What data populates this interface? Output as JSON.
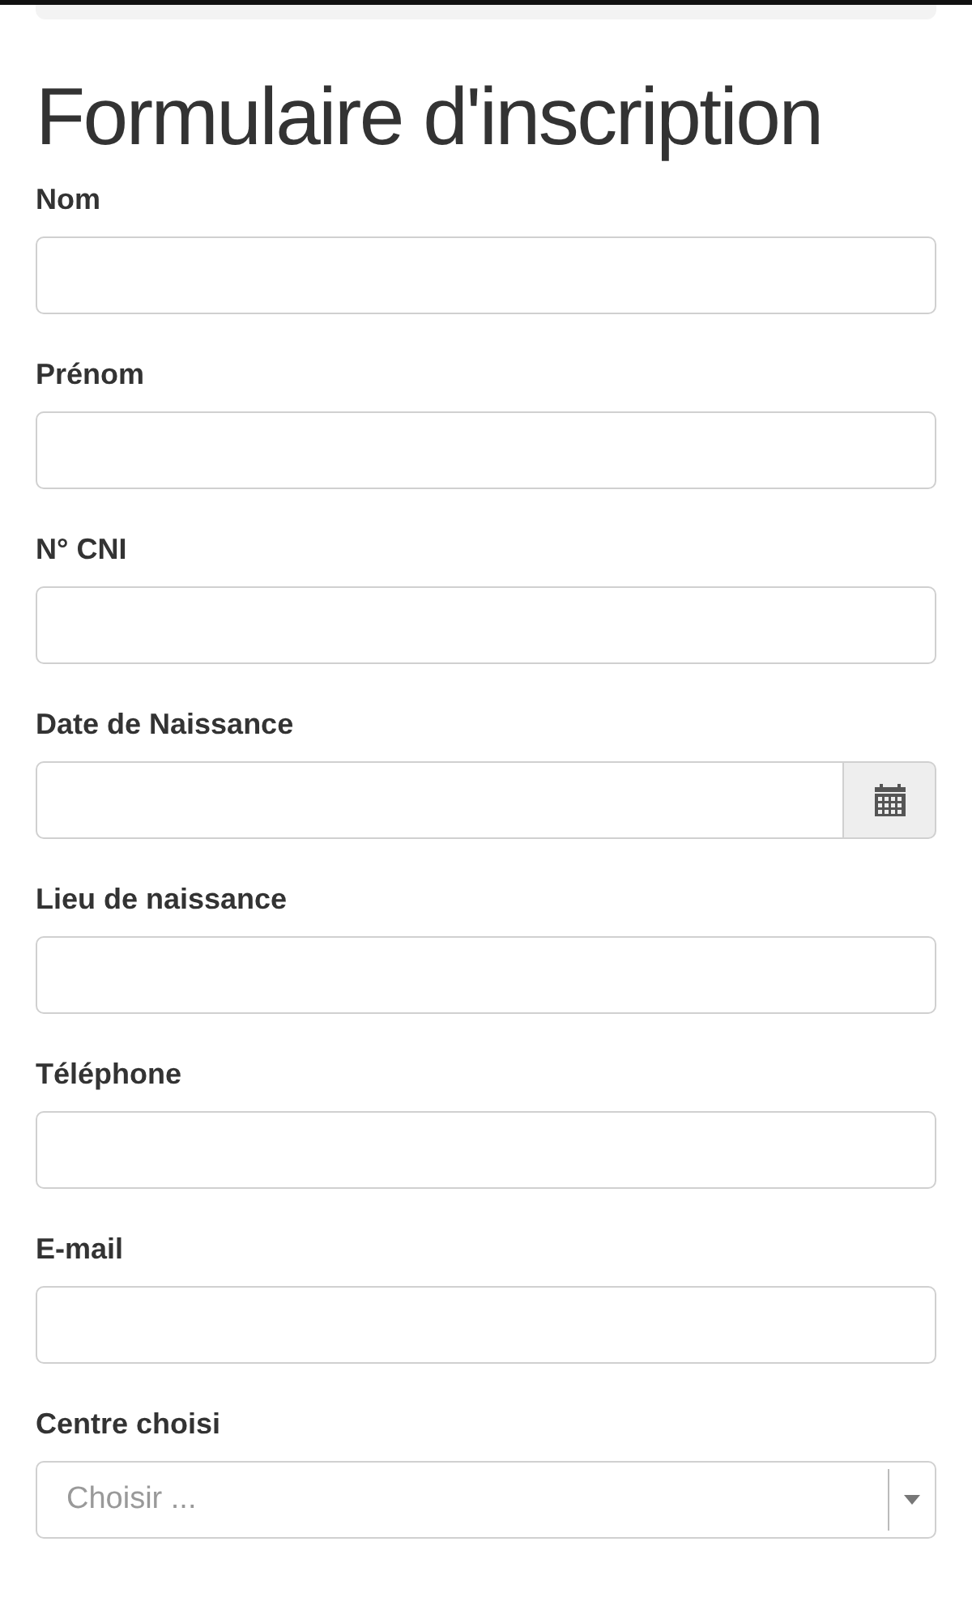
{
  "title": "Formulaire d'inscription",
  "fields": [
    {
      "label": "Nom",
      "kind": "text"
    },
    {
      "label": "Prénom",
      "kind": "text"
    },
    {
      "label": "N° CNI",
      "kind": "text"
    },
    {
      "label": "Date de Naissance",
      "kind": "date"
    },
    {
      "label": "Lieu de naissance",
      "kind": "text"
    },
    {
      "label": "Téléphone",
      "kind": "text"
    },
    {
      "label": "E-mail",
      "kind": "text"
    },
    {
      "label": "Centre choisi",
      "kind": "select",
      "placeholder": "Choisir ..."
    }
  ]
}
